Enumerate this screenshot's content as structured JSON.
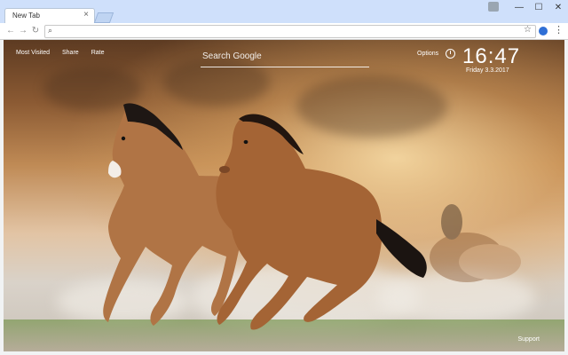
{
  "browser": {
    "tab_title": "New Tab",
    "tab_close": "×",
    "window_controls": [
      "—",
      "☐",
      "✕"
    ],
    "omnibox_placeholder": "",
    "star_icon": "☆",
    "menu_icon": "⋮"
  },
  "nav": {
    "items": [
      "Most Visited",
      "Share",
      "Rate"
    ]
  },
  "search": {
    "placeholder": "Search Google"
  },
  "widgets": {
    "options_label": "Options",
    "time": "16:47",
    "date": "Friday  3.3.2017",
    "support_label": "Support"
  }
}
